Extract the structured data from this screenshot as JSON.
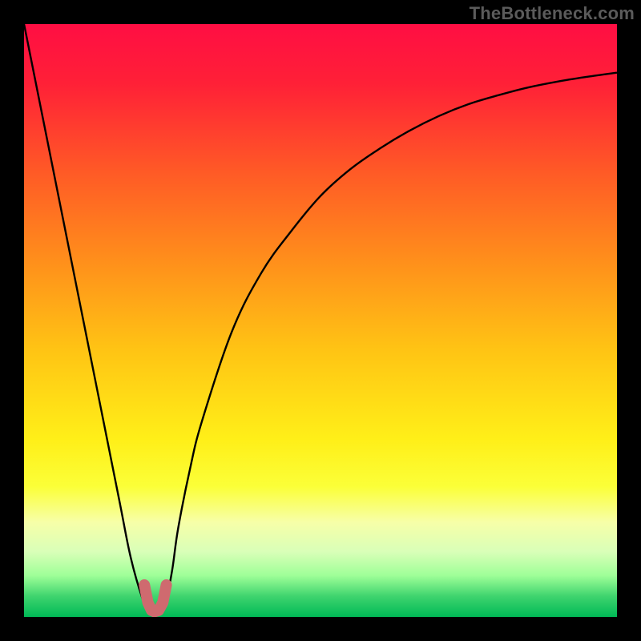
{
  "watermark": "TheBottleneck.com",
  "chart_data": {
    "type": "line",
    "title": "",
    "xlabel": "",
    "ylabel": "",
    "xlim": [
      0,
      100
    ],
    "ylim": [
      0,
      100
    ],
    "grid": false,
    "legend": false,
    "series": [
      {
        "name": "bottleneck-curve",
        "x": [
          0,
          4,
          8,
          12,
          16,
          18,
          20,
          21,
          22,
          23,
          24,
          25,
          26,
          28,
          30,
          35,
          40,
          45,
          50,
          55,
          60,
          65,
          70,
          75,
          80,
          85,
          90,
          95,
          100
        ],
        "y": [
          100,
          80,
          60,
          40,
          20,
          10,
          3,
          1.2,
          1,
          1.2,
          3,
          8,
          15,
          25,
          33,
          48,
          58,
          65,
          71,
          75.5,
          79,
          82,
          84.5,
          86.5,
          88,
          89.3,
          90.3,
          91.1,
          91.8
        ]
      },
      {
        "name": "marker-u",
        "x": [
          20.3,
          20.9,
          21.5,
          22,
          22.7,
          23.4,
          24.0
        ],
        "y": [
          5.4,
          2.4,
          1.1,
          0.9,
          1.1,
          2.4,
          5.4
        ]
      }
    ],
    "background_gradient": {
      "stops": [
        {
          "offset": 0.0,
          "color": "#ff0e43"
        },
        {
          "offset": 0.1,
          "color": "#ff2037"
        },
        {
          "offset": 0.25,
          "color": "#ff5a26"
        },
        {
          "offset": 0.4,
          "color": "#ff8f1b"
        },
        {
          "offset": 0.55,
          "color": "#ffc414"
        },
        {
          "offset": 0.7,
          "color": "#ffef18"
        },
        {
          "offset": 0.78,
          "color": "#fbff38"
        },
        {
          "offset": 0.84,
          "color": "#f7ffa8"
        },
        {
          "offset": 0.89,
          "color": "#d9ffb8"
        },
        {
          "offset": 0.93,
          "color": "#9fff98"
        },
        {
          "offset": 0.965,
          "color": "#3fd46e"
        },
        {
          "offset": 1.0,
          "color": "#00b956"
        }
      ]
    },
    "colors": {
      "curve": "#000000",
      "marker": "#cf6a6f"
    }
  }
}
